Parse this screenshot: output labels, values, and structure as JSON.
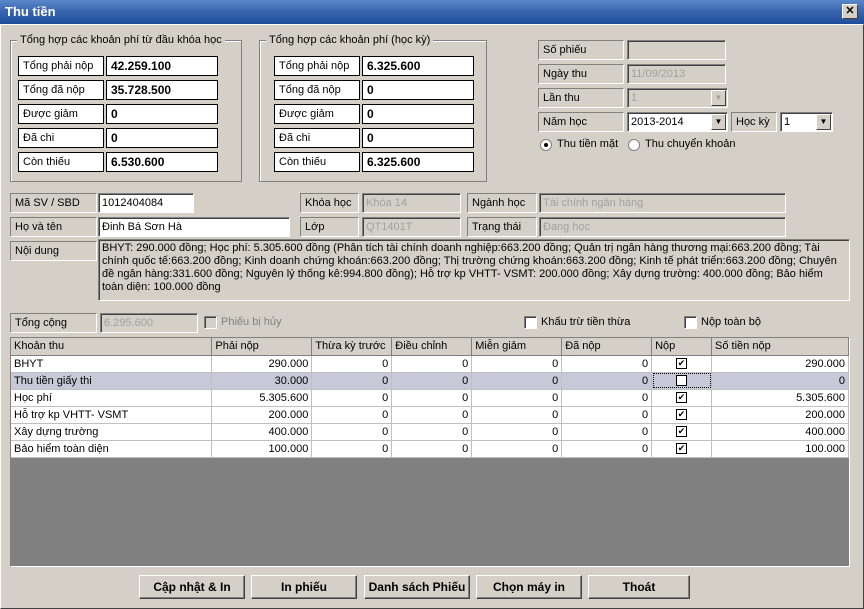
{
  "window": {
    "title": "Thu tiền",
    "close_glyph": "✕"
  },
  "summary_course": {
    "legend": "Tổng hợp các khoản phí từ đầu khóa học",
    "rows": [
      {
        "label": "Tổng phải nộp",
        "value": "42.259.100"
      },
      {
        "label": "Tổng đã nộp",
        "value": "35.728.500"
      },
      {
        "label": "Được giảm",
        "value": "0"
      },
      {
        "label": "Đã chi",
        "value": "0"
      },
      {
        "label": "Còn thiếu",
        "value": "6.530.600"
      }
    ]
  },
  "summary_term": {
    "legend": "Tổng hợp các khoản phí (học kỳ)",
    "rows": [
      {
        "label": "Tổng phải nộp",
        "value": "6.325.600"
      },
      {
        "label": "Tổng đã nộp",
        "value": "0"
      },
      {
        "label": "Được giảm",
        "value": "0"
      },
      {
        "label": "Đã chi",
        "value": "0"
      },
      {
        "label": "Còn thiếu",
        "value": "6.325.600"
      }
    ]
  },
  "receipt": {
    "so_phieu_label": "Số phiếu",
    "so_phieu": "",
    "ngay_thu_label": "Ngày thu",
    "ngay_thu": "11/09/2013",
    "lan_thu_label": "Lần thu",
    "lan_thu": "1",
    "nam_hoc_label": "Năm học",
    "nam_hoc": "2013-2014",
    "hoc_ky_label": "Học kỳ",
    "hoc_ky": "1",
    "pay_cash": "Thu tiền mặt",
    "pay_transfer": "Thu chuyển khoản"
  },
  "student": {
    "msv_label": "Mã SV / SBD",
    "msv": "1012404084",
    "name_label": "Họ và tên",
    "name": "Đinh Bá Sơn Hà",
    "khoa_label": "Khóa học",
    "khoa": "Khóa 14",
    "lop_label": "Lớp",
    "lop": "QT1401T",
    "nganh_label": "Ngành học",
    "nganh": "Tài chính ngân hàng",
    "trang_thai_label": "Trạng thái",
    "trang_thai": "Đang học"
  },
  "content": {
    "label": "Nội dung",
    "text": "BHYT: 290.000 đồng; Học phí: 5.305.600 đồng (Phân tích tài chính doanh nghiệp:663.200 đồng; Quản trị ngân hàng thương mại:663.200 đồng; Tài chính quốc tế:663.200 đồng; Kinh doanh chứng khoán:663.200 đồng; Thị trường chứng khoán:663.200 đồng; Kinh tế phát triển:663.200 đồng; Chuyên đề ngân hàng:331.600 đồng; Nguyên lý thống kê:994.800 đồng); Hỗ trợ kp VHTT- VSMT: 200.000 đồng; Xây dựng trường: 400.000 đồng; Bảo hiểm toàn diện: 100.000 đồng"
  },
  "totals": {
    "tong_cong_label": "Tổng cộng",
    "tong_cong": "6.295.600",
    "phieu_huy": "Phiếu bị hủy",
    "khau_tru": "Khấu trừ tiền thừa",
    "nop_toan_bo": "Nộp toàn bộ"
  },
  "table": {
    "headers": [
      "Khoản thu",
      "Phải nộp",
      "Thừa kỳ trước",
      "Điều chỉnh",
      "Miễn giảm",
      "Đã nộp",
      "Nộp",
      "Số tiền nộp"
    ],
    "rows": [
      {
        "name": "BHYT",
        "phai_nop": "290.000",
        "thua": "0",
        "dieu_chinh": "0",
        "mien_giam": "0",
        "da_nop": "0",
        "nop": true,
        "so_tien": "290.000"
      },
      {
        "name": "Thu tiền giấy thi",
        "phai_nop": "30.000",
        "thua": "0",
        "dieu_chinh": "0",
        "mien_giam": "0",
        "da_nop": "0",
        "nop": false,
        "so_tien": "0"
      },
      {
        "name": "Học phí",
        "phai_nop": "5.305.600",
        "thua": "0",
        "dieu_chinh": "0",
        "mien_giam": "0",
        "da_nop": "0",
        "nop": true,
        "so_tien": "5.305.600"
      },
      {
        "name": "Hỗ trợ kp VHTT- VSMT",
        "phai_nop": "200.000",
        "thua": "0",
        "dieu_chinh": "0",
        "mien_giam": "0",
        "da_nop": "0",
        "nop": true,
        "so_tien": "200.000"
      },
      {
        "name": "Xây dựng trường",
        "phai_nop": "400.000",
        "thua": "0",
        "dieu_chinh": "0",
        "mien_giam": "0",
        "da_nop": "0",
        "nop": true,
        "so_tien": "400.000"
      },
      {
        "name": "Bảo hiểm toàn diện",
        "phai_nop": "100.000",
        "thua": "0",
        "dieu_chinh": "0",
        "mien_giam": "0",
        "da_nop": "0",
        "nop": true,
        "so_tien": "100.000"
      }
    ]
  },
  "buttons": {
    "update_print": "Cập nhật & In",
    "print": "In phiếu",
    "list": "Danh sách Phiếu",
    "choose_printer": "Chọn máy in",
    "exit": "Thoát"
  }
}
